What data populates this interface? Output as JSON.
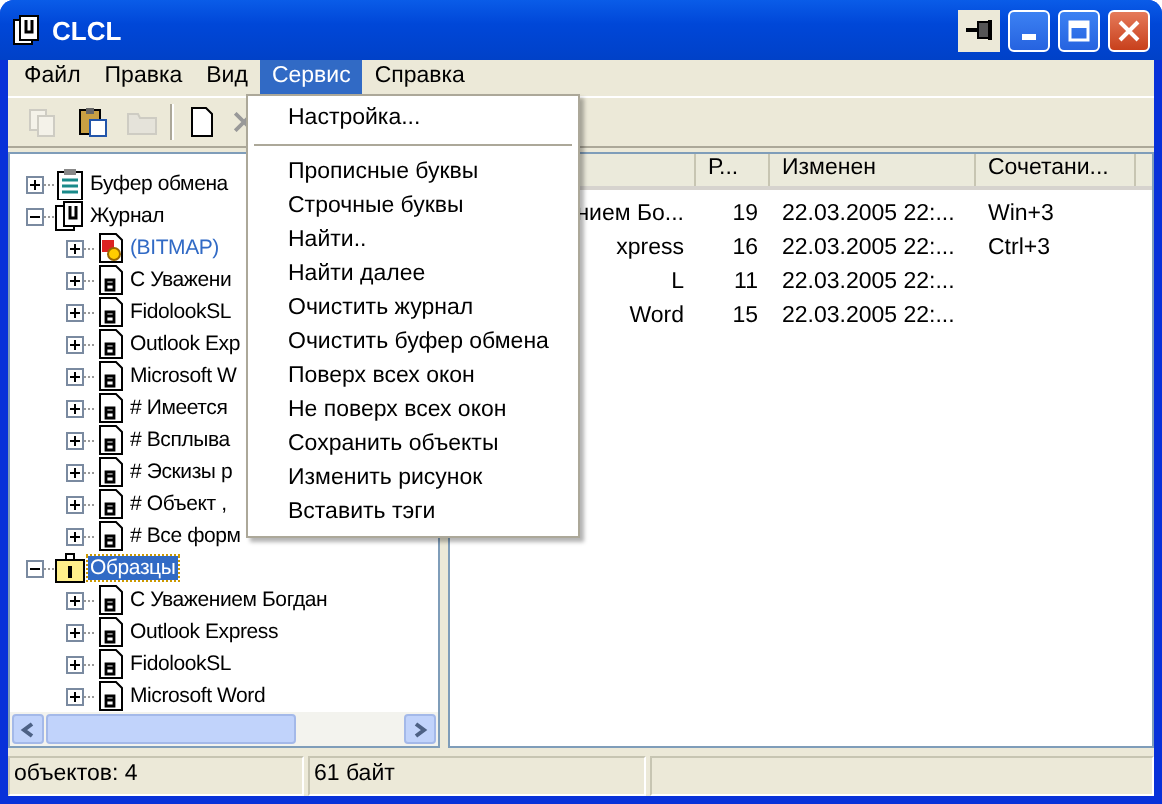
{
  "window": {
    "title": "CLCL"
  },
  "menu_bar": [
    {
      "label": "Файл",
      "selected": false
    },
    {
      "label": "Правка",
      "selected": false
    },
    {
      "label": "Вид",
      "selected": false
    },
    {
      "label": "Сервис",
      "selected": true
    },
    {
      "label": "Справка",
      "selected": false
    }
  ],
  "toolbar": [
    {
      "kind": "copy",
      "disabled": true
    },
    {
      "kind": "paste",
      "disabled": false
    },
    {
      "kind": "folder",
      "disabled": true
    },
    {
      "kind": "separator"
    },
    {
      "kind": "new",
      "disabled": false
    },
    {
      "kind": "delete",
      "disabled": false
    }
  ],
  "tree": [
    {
      "label": "Буфер обмена",
      "kind": "clipboard",
      "expanded": false,
      "selected": false
    },
    {
      "label": "Журнал",
      "kind": "journal",
      "expanded": true,
      "selected": false,
      "children": [
        {
          "label": "(BITMAP)",
          "kind": "bitmap",
          "expanded": false,
          "selected": false
        },
        {
          "label": "С Уважени",
          "kind": "text",
          "expanded": false,
          "selected": false
        },
        {
          "label": "FidolookSL",
          "kind": "text",
          "expanded": false,
          "selected": false
        },
        {
          "label": "Outlook Exp",
          "kind": "text",
          "expanded": false,
          "selected": false
        },
        {
          "label": "Microsoft W",
          "kind": "text",
          "expanded": false,
          "selected": false
        },
        {
          "label": "# Имеется",
          "kind": "text",
          "expanded": false,
          "selected": false
        },
        {
          "label": "# Всплыва",
          "kind": "text",
          "expanded": false,
          "selected": false
        },
        {
          "label": "# Эскизы р",
          "kind": "text",
          "expanded": false,
          "selected": false
        },
        {
          "label": "# Объект ,",
          "kind": "text",
          "expanded": false,
          "selected": false
        },
        {
          "label": "# Все форм",
          "kind": "text",
          "expanded": false,
          "selected": false
        }
      ]
    },
    {
      "label": "Образцы",
      "kind": "samples",
      "expanded": true,
      "selected": true,
      "children": [
        {
          "label": "С Уважением Богдан",
          "kind": "text",
          "expanded": false,
          "selected": false
        },
        {
          "label": "Outlook Express",
          "kind": "text",
          "expanded": false,
          "selected": false
        },
        {
          "label": "FidolookSL",
          "kind": "text",
          "expanded": false,
          "selected": false
        },
        {
          "label": "Microsoft Word",
          "kind": "text",
          "expanded": false,
          "selected": false
        }
      ]
    }
  ],
  "list": {
    "columns": [
      "Р...",
      "Изменен",
      "Сочетани..."
    ],
    "rows": [
      {
        "name": "нием Бо...",
        "size": "19",
        "modified": "22.03.2005 22:...",
        "hotkey": "Win+3"
      },
      {
        "name": "xpress",
        "size": "16",
        "modified": "22.03.2005 22:...",
        "hotkey": "Ctrl+3"
      },
      {
        "name": "L",
        "size": "11",
        "modified": "22.03.2005 22:..."
      },
      {
        "name": "Word",
        "size": "15",
        "modified": "22.03.2005 22:..."
      }
    ]
  },
  "dropdown_menu": [
    {
      "kind": "item",
      "label": "Настройка..."
    },
    {
      "kind": "separator"
    },
    {
      "kind": "item",
      "label": "Прописные буквы"
    },
    {
      "kind": "item",
      "label": "Строчные буквы"
    },
    {
      "kind": "item",
      "label": "Найти.."
    },
    {
      "kind": "item",
      "label": "Найти далее"
    },
    {
      "kind": "item",
      "label": "Очистить журнал"
    },
    {
      "kind": "item",
      "label": "Очистить буфер обмена"
    },
    {
      "kind": "item",
      "label": "Поверх всех окон"
    },
    {
      "kind": "item",
      "label": "Не поверх всех окон"
    },
    {
      "kind": "item",
      "label": "Сохранить объекты"
    },
    {
      "kind": "item",
      "label": "Изменить рисунок"
    },
    {
      "kind": "item",
      "label": "Вставить тэги"
    }
  ],
  "status_bar": [
    "объектов: 4",
    "61 байт"
  ]
}
